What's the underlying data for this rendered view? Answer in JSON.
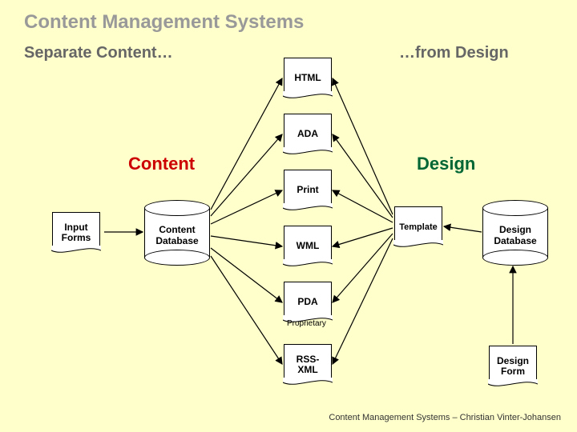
{
  "title": "Content Management Systems",
  "subtitle_left": "Separate Content…",
  "subtitle_right": "…from Design",
  "section_content": "Content",
  "section_design": "Design",
  "nodes": {
    "input_forms": "Input\nForms",
    "content_db": "Content\nDatabase",
    "html": "HTML",
    "ada": "ADA",
    "print": "Print",
    "wml": "WML",
    "pda": "PDA",
    "pda_sub": "Proprietary",
    "rss": "RSS-\nXML",
    "template": "Template",
    "design_db": "Design\nDatabase",
    "design_form": "Design\nForm"
  },
  "colors": {
    "content": "#cc0000",
    "design": "#006633"
  },
  "footer": "Content Management Systems – Christian Vinter-Johansen"
}
